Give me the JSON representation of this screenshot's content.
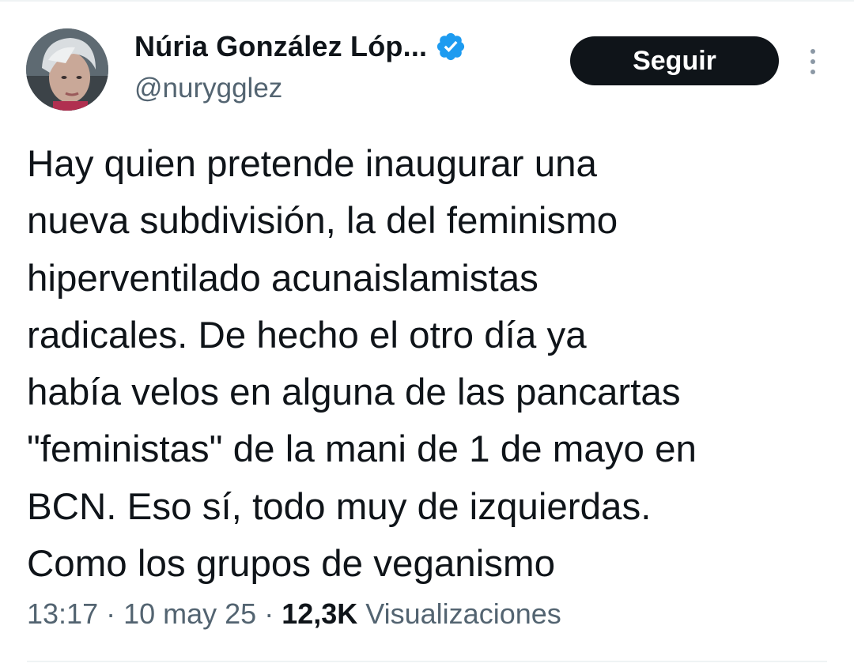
{
  "author": {
    "display_name": "Núria González Lóp...",
    "handle": "@nurygglez",
    "verified": true,
    "avatar": "profile-photo"
  },
  "actions": {
    "follow_label": "Seguir",
    "more_icon": "more-vertical-icon"
  },
  "tweet": {
    "lines": [
      "Hay quien pretende inaugurar una",
      "nueva subdivisión, la del feminismo",
      "hiperventilado acunaislamistas",
      "radicales. De hecho el otro día ya",
      "había velos en alguna de las pancartas",
      "\"feministas\" de la mani de 1 de mayo en",
      "BCN. Eso sí, todo muy de izquierdas.",
      "Como los grupos de veganismo"
    ]
  },
  "meta": {
    "time": "13:17",
    "separator": "·",
    "date": "10 may 25",
    "views_count": "12,3K",
    "views_label": "Visualizaciones"
  },
  "colors": {
    "text": "#0f1419",
    "secondary_text": "#536471",
    "verified_blue": "#1d9bf0",
    "follow_bg": "#0f1419",
    "border": "#eff3f4"
  }
}
